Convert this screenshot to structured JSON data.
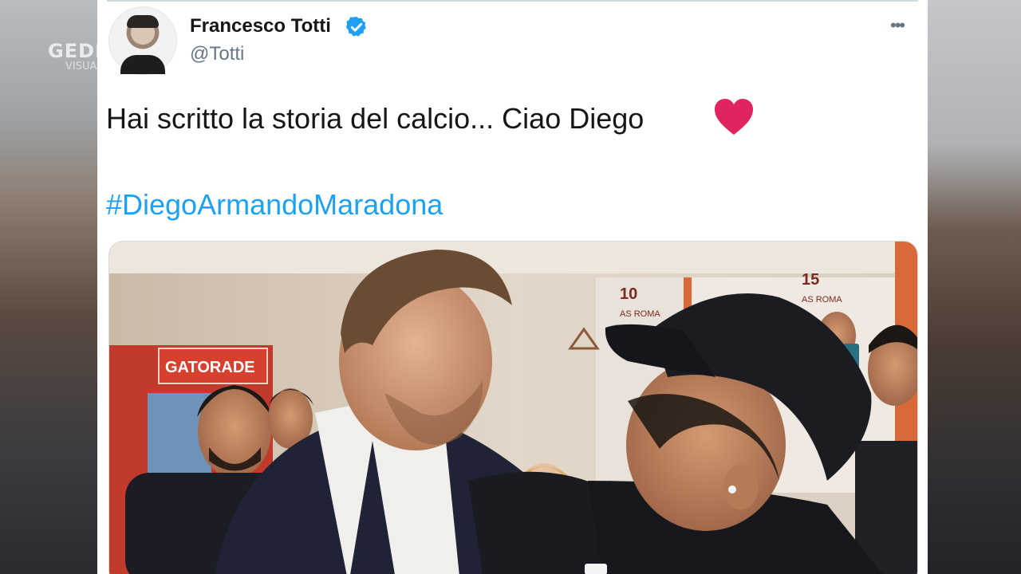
{
  "watermark": {
    "logo": "GEDI",
    "sub": "VISUAL"
  },
  "tweet": {
    "author_name": "Francesco Totti",
    "handle": "@Totti",
    "verified": true,
    "more_label": "•••",
    "text": "Hai scritto la storia del calcio... Ciao Diego",
    "emoji": "heart-icon",
    "hashtag": "#DiegoArmandoMaradona"
  },
  "photo": {
    "sign_text": "GATORADE",
    "shirt_numbers": [
      "10",
      "15"
    ],
    "shirt_text": "AS ROMA"
  },
  "colors": {
    "link": "#1da1f2",
    "verified": "#1da1f2",
    "heart": "#e0245e",
    "text": "#14171a",
    "secondary": "#657786"
  }
}
